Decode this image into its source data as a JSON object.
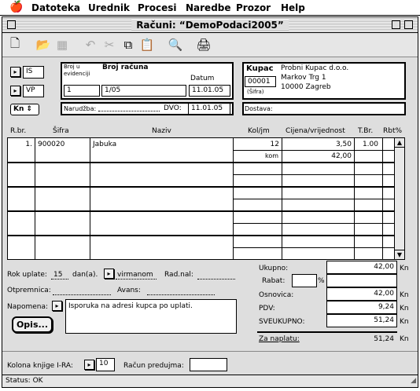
{
  "menu": {
    "items": [
      "Datoteka",
      "Urednik",
      "Procesi",
      "Naredbe",
      "Prozor",
      "Help"
    ]
  },
  "window": {
    "title": "Računi: “DemoPodaci2005”"
  },
  "icons": [
    "new-document-icon",
    "open-folder-icon",
    "save-disk-icon",
    "undo-icon",
    "cut-icon",
    "copy-icon",
    "paste-icon",
    "find-icon",
    "print-icon"
  ],
  "doc_type": {
    "is": "IS",
    "vp": "VP",
    "currency": "Kn"
  },
  "header": {
    "broj_evidencije_label": "Broj u evidenciji",
    "broj_evidencije": "1",
    "broj_racuna_label": "Broj računa",
    "broj_racuna": "1/05",
    "datum_label": "Datum",
    "datum": "11.01.05",
    "narudzba_label": "Narudžba:",
    "narudzba": "",
    "dvo_label": "DVO:",
    "dvo": "11.01.05"
  },
  "kupac": {
    "label": "Kupac",
    "sifra": "00001",
    "sifra_label": "(Šifra)",
    "name": "Probni Kupac d.o.o.",
    "street": "Markov Trg 1",
    "city": "10000 Zagreb",
    "dostava_label": "Dostava:",
    "dostava": ""
  },
  "table": {
    "headers": {
      "rbr": "R.br.",
      "sifra": "Šifra",
      "naziv": "Naziv",
      "kol": "Kol/jm",
      "cijena": "Cijena/vrijednost",
      "tbr": "T.Br.",
      "rbt": "Rbt%"
    },
    "rows": [
      {
        "rbr": "1.",
        "sifra": "900020",
        "naziv": "Jabuka",
        "kol": "12",
        "jm": "kom",
        "cijena": "3,50",
        "vrijednost": "42,00",
        "tbr": "1.00",
        "rbt": ""
      }
    ]
  },
  "footer": {
    "rok_label": "Rok uplate:",
    "rok": "15",
    "dana_label": "dan(a).",
    "placanje": "virmanom",
    "radnal_label": "Rad.nal:",
    "radnal": "",
    "otpremnica_label": "Otpremnica:",
    "otpremnica": "",
    "avans_label": "Avans:",
    "avans": "",
    "napomena_label": "Napomena:",
    "napomena": "Isporuka na adresi kupca po uplati.",
    "opis_button": "Opis...",
    "kolona_label": "Kolona knjige I-RA:",
    "kolona": "10",
    "predujam_label": "Račun predujma:",
    "predujam": ""
  },
  "totals": {
    "ukupno_label": "Ukupno:",
    "ukupno": "42,00",
    "rabat_label": "Rabat:",
    "rabat": "",
    "pct": "%",
    "osnovica_label": "Osnovica:",
    "osnovica": "42,00",
    "pdv_label": "PDV:",
    "pdv": "9,24",
    "sveukupno_label": "SVEUKUPNO:",
    "sveukupno": "51,24",
    "zanaplatu_label": "Za naplatu:",
    "zanaplatu": "51,24",
    "currency": "Kn"
  },
  "status": {
    "text": "Status: OK"
  }
}
